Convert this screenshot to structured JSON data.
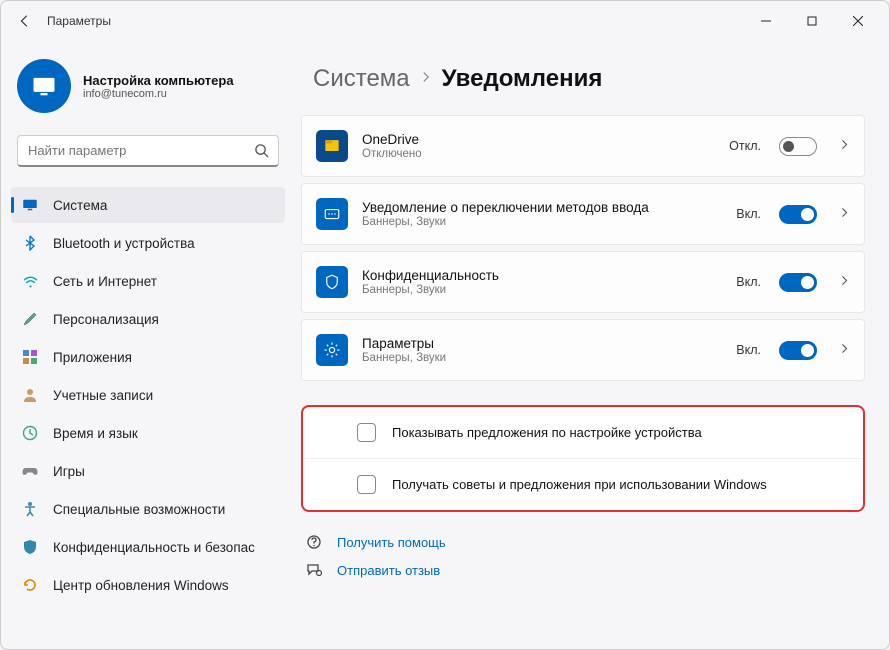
{
  "window": {
    "title": "Параметры"
  },
  "account": {
    "name": "Настройка компьютера",
    "email": "info@tunecom.ru"
  },
  "search": {
    "placeholder": "Найти параметр"
  },
  "nav": {
    "items": [
      {
        "label": "Система",
        "icon": "🖥️",
        "selected": true
      },
      {
        "label": "Bluetooth и устройства",
        "icon": "bt"
      },
      {
        "label": "Сеть и Интернет",
        "icon": "wifi"
      },
      {
        "label": "Персонализация",
        "icon": "brush"
      },
      {
        "label": "Приложения",
        "icon": "apps"
      },
      {
        "label": "Учетные записи",
        "icon": "user"
      },
      {
        "label": "Время и язык",
        "icon": "clock"
      },
      {
        "label": "Игры",
        "icon": "game"
      },
      {
        "label": "Специальные возможности",
        "icon": "access"
      },
      {
        "label": "Конфиденциальность и безопас",
        "icon": "shield"
      },
      {
        "label": "Центр обновления Windows",
        "icon": "update"
      }
    ]
  },
  "breadcrumb": {
    "parent": "Система",
    "current": "Уведомления"
  },
  "rows": [
    {
      "title": "OneDrive",
      "sub": "Отключено",
      "state": "Откл.",
      "on": false
    },
    {
      "title": "Уведомление о переключении методов ввода",
      "sub": "Баннеры, Звуки",
      "state": "Вкл.",
      "on": true
    },
    {
      "title": "Конфиденциальность",
      "sub": "Баннеры, Звуки",
      "state": "Вкл.",
      "on": true
    },
    {
      "title": "Параметры",
      "sub": "Баннеры, Звуки",
      "state": "Вкл.",
      "on": true
    }
  ],
  "checks": [
    {
      "label": "Показывать предложения по настройке устройства"
    },
    {
      "label": "Получать советы и предложения при использовании Windows"
    }
  ],
  "footer": {
    "help": "Получить помощь",
    "feedback": "Отправить отзыв"
  }
}
